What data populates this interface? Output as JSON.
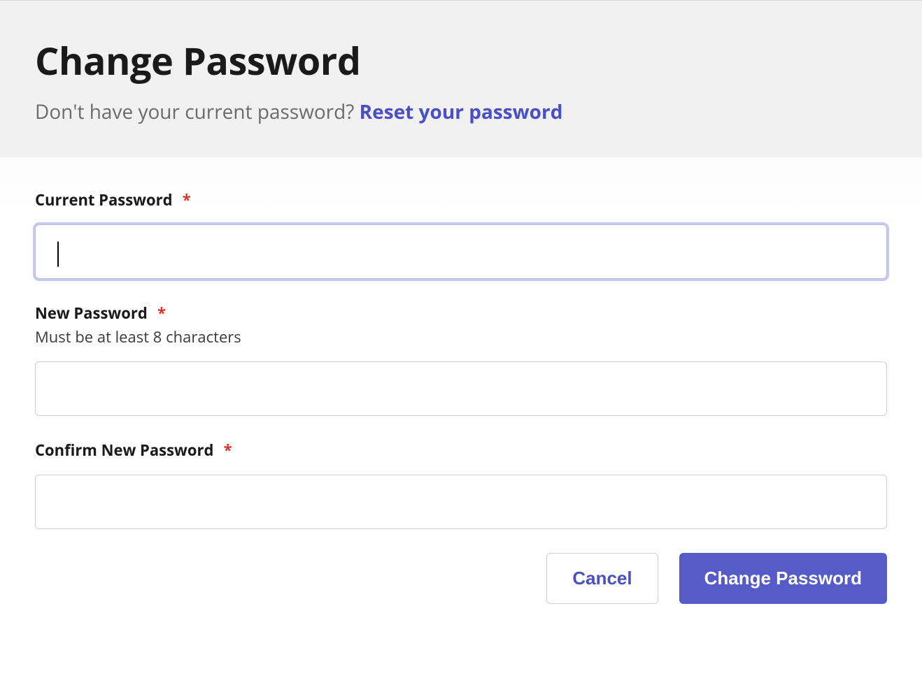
{
  "header": {
    "title": "Change Password",
    "subtitle_prefix": "Don't have your current password? ",
    "reset_link_label": "Reset your password"
  },
  "form": {
    "current_password": {
      "label": "Current Password",
      "required": "*",
      "value": ""
    },
    "new_password": {
      "label": "New Password",
      "required": "*",
      "helper": "Must be at least 8 characters",
      "value": ""
    },
    "confirm_password": {
      "label": "Confirm New Password",
      "required": "*",
      "value": ""
    }
  },
  "buttons": {
    "cancel": "Cancel",
    "submit": "Change Password"
  }
}
